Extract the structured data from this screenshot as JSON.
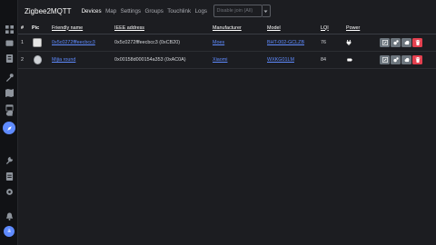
{
  "sidebar": {
    "items": [
      {
        "name": "dashboard-icon"
      },
      {
        "name": "devices-icon"
      },
      {
        "name": "card-icon"
      },
      {
        "name": "tools-icon"
      },
      {
        "name": "map-icon"
      },
      {
        "name": "calendar-icon"
      },
      {
        "name": "cloud-icon"
      },
      {
        "name": "compass-icon",
        "active": true
      },
      {
        "name": "wrench-icon"
      },
      {
        "name": "logs-icon"
      },
      {
        "name": "settings-icon"
      },
      {
        "name": "bell-icon"
      }
    ],
    "avatar_letter": "a"
  },
  "header": {
    "title": "Zigbee2MQTT",
    "nav": [
      "Devices",
      "Map",
      "Settings",
      "Groups",
      "Touchlink",
      "Logs"
    ],
    "active_nav": "Devices",
    "permit_join_label": "Disable join (All)"
  },
  "table": {
    "columns": {
      "num": "#",
      "pic": "Pic",
      "name": "Friendly name",
      "ieee": "IEEE address",
      "manufacturer": "Manufacturer",
      "model": "Model",
      "lqi": "LQI",
      "power": "Power"
    },
    "rows": [
      {
        "num": "1",
        "name": "0x5c0272fffeecbcc3",
        "ieee": "0x5c0272fffeecbcc3 (0xCB20)",
        "manufacturer": "Moes",
        "model": "BHT-002-GCLZB",
        "lqi": "76",
        "power_icon": "plug-icon"
      },
      {
        "num": "2",
        "name": "Mijia round",
        "ieee": "0x00158d000154a353 (0xAC0A)",
        "manufacturer": "Xiaomi",
        "model": "WXKG01LM",
        "lqi": "84",
        "power_icon": "battery-icon"
      }
    ]
  },
  "colors": {
    "background": "#1c1d21",
    "sidebar": "#111215",
    "accent": "#5f8bff",
    "danger": "#e4404f",
    "secondary": "#6c757d"
  }
}
